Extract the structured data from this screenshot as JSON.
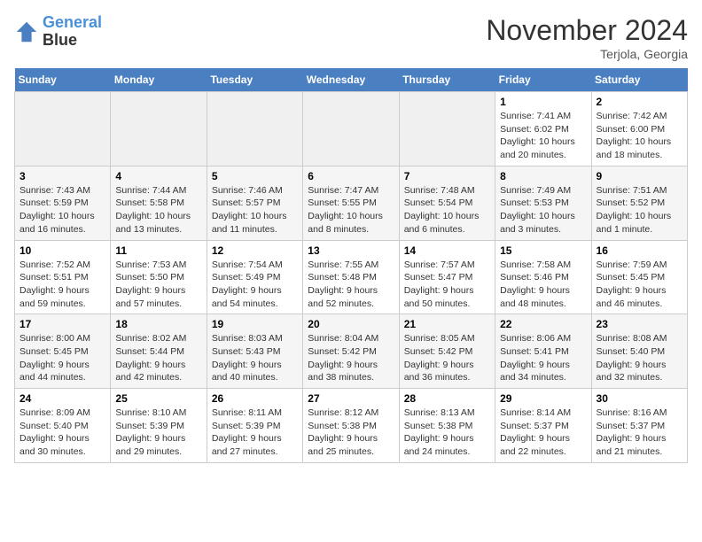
{
  "logo": {
    "line1": "General",
    "line2": "Blue"
  },
  "title": "November 2024",
  "location": "Terjola, Georgia",
  "days_of_week": [
    "Sunday",
    "Monday",
    "Tuesday",
    "Wednesday",
    "Thursday",
    "Friday",
    "Saturday"
  ],
  "weeks": [
    [
      {
        "day": "",
        "sunrise": "",
        "sunset": "",
        "daylight": ""
      },
      {
        "day": "",
        "sunrise": "",
        "sunset": "",
        "daylight": ""
      },
      {
        "day": "",
        "sunrise": "",
        "sunset": "",
        "daylight": ""
      },
      {
        "day": "",
        "sunrise": "",
        "sunset": "",
        "daylight": ""
      },
      {
        "day": "",
        "sunrise": "",
        "sunset": "",
        "daylight": ""
      },
      {
        "day": "1",
        "sunrise": "Sunrise: 7:41 AM",
        "sunset": "Sunset: 6:02 PM",
        "daylight": "Daylight: 10 hours and 20 minutes."
      },
      {
        "day": "2",
        "sunrise": "Sunrise: 7:42 AM",
        "sunset": "Sunset: 6:00 PM",
        "daylight": "Daylight: 10 hours and 18 minutes."
      }
    ],
    [
      {
        "day": "3",
        "sunrise": "Sunrise: 7:43 AM",
        "sunset": "Sunset: 5:59 PM",
        "daylight": "Daylight: 10 hours and 16 minutes."
      },
      {
        "day": "4",
        "sunrise": "Sunrise: 7:44 AM",
        "sunset": "Sunset: 5:58 PM",
        "daylight": "Daylight: 10 hours and 13 minutes."
      },
      {
        "day": "5",
        "sunrise": "Sunrise: 7:46 AM",
        "sunset": "Sunset: 5:57 PM",
        "daylight": "Daylight: 10 hours and 11 minutes."
      },
      {
        "day": "6",
        "sunrise": "Sunrise: 7:47 AM",
        "sunset": "Sunset: 5:55 PM",
        "daylight": "Daylight: 10 hours and 8 minutes."
      },
      {
        "day": "7",
        "sunrise": "Sunrise: 7:48 AM",
        "sunset": "Sunset: 5:54 PM",
        "daylight": "Daylight: 10 hours and 6 minutes."
      },
      {
        "day": "8",
        "sunrise": "Sunrise: 7:49 AM",
        "sunset": "Sunset: 5:53 PM",
        "daylight": "Daylight: 10 hours and 3 minutes."
      },
      {
        "day": "9",
        "sunrise": "Sunrise: 7:51 AM",
        "sunset": "Sunset: 5:52 PM",
        "daylight": "Daylight: 10 hours and 1 minute."
      }
    ],
    [
      {
        "day": "10",
        "sunrise": "Sunrise: 7:52 AM",
        "sunset": "Sunset: 5:51 PM",
        "daylight": "Daylight: 9 hours and 59 minutes."
      },
      {
        "day": "11",
        "sunrise": "Sunrise: 7:53 AM",
        "sunset": "Sunset: 5:50 PM",
        "daylight": "Daylight: 9 hours and 57 minutes."
      },
      {
        "day": "12",
        "sunrise": "Sunrise: 7:54 AM",
        "sunset": "Sunset: 5:49 PM",
        "daylight": "Daylight: 9 hours and 54 minutes."
      },
      {
        "day": "13",
        "sunrise": "Sunrise: 7:55 AM",
        "sunset": "Sunset: 5:48 PM",
        "daylight": "Daylight: 9 hours and 52 minutes."
      },
      {
        "day": "14",
        "sunrise": "Sunrise: 7:57 AM",
        "sunset": "Sunset: 5:47 PM",
        "daylight": "Daylight: 9 hours and 50 minutes."
      },
      {
        "day": "15",
        "sunrise": "Sunrise: 7:58 AM",
        "sunset": "Sunset: 5:46 PM",
        "daylight": "Daylight: 9 hours and 48 minutes."
      },
      {
        "day": "16",
        "sunrise": "Sunrise: 7:59 AM",
        "sunset": "Sunset: 5:45 PM",
        "daylight": "Daylight: 9 hours and 46 minutes."
      }
    ],
    [
      {
        "day": "17",
        "sunrise": "Sunrise: 8:00 AM",
        "sunset": "Sunset: 5:45 PM",
        "daylight": "Daylight: 9 hours and 44 minutes."
      },
      {
        "day": "18",
        "sunrise": "Sunrise: 8:02 AM",
        "sunset": "Sunset: 5:44 PM",
        "daylight": "Daylight: 9 hours and 42 minutes."
      },
      {
        "day": "19",
        "sunrise": "Sunrise: 8:03 AM",
        "sunset": "Sunset: 5:43 PM",
        "daylight": "Daylight: 9 hours and 40 minutes."
      },
      {
        "day": "20",
        "sunrise": "Sunrise: 8:04 AM",
        "sunset": "Sunset: 5:42 PM",
        "daylight": "Daylight: 9 hours and 38 minutes."
      },
      {
        "day": "21",
        "sunrise": "Sunrise: 8:05 AM",
        "sunset": "Sunset: 5:42 PM",
        "daylight": "Daylight: 9 hours and 36 minutes."
      },
      {
        "day": "22",
        "sunrise": "Sunrise: 8:06 AM",
        "sunset": "Sunset: 5:41 PM",
        "daylight": "Daylight: 9 hours and 34 minutes."
      },
      {
        "day": "23",
        "sunrise": "Sunrise: 8:08 AM",
        "sunset": "Sunset: 5:40 PM",
        "daylight": "Daylight: 9 hours and 32 minutes."
      }
    ],
    [
      {
        "day": "24",
        "sunrise": "Sunrise: 8:09 AM",
        "sunset": "Sunset: 5:40 PM",
        "daylight": "Daylight: 9 hours and 30 minutes."
      },
      {
        "day": "25",
        "sunrise": "Sunrise: 8:10 AM",
        "sunset": "Sunset: 5:39 PM",
        "daylight": "Daylight: 9 hours and 29 minutes."
      },
      {
        "day": "26",
        "sunrise": "Sunrise: 8:11 AM",
        "sunset": "Sunset: 5:39 PM",
        "daylight": "Daylight: 9 hours and 27 minutes."
      },
      {
        "day": "27",
        "sunrise": "Sunrise: 8:12 AM",
        "sunset": "Sunset: 5:38 PM",
        "daylight": "Daylight: 9 hours and 25 minutes."
      },
      {
        "day": "28",
        "sunrise": "Sunrise: 8:13 AM",
        "sunset": "Sunset: 5:38 PM",
        "daylight": "Daylight: 9 hours and 24 minutes."
      },
      {
        "day": "29",
        "sunrise": "Sunrise: 8:14 AM",
        "sunset": "Sunset: 5:37 PM",
        "daylight": "Daylight: 9 hours and 22 minutes."
      },
      {
        "day": "30",
        "sunrise": "Sunrise: 8:16 AM",
        "sunset": "Sunset: 5:37 PM",
        "daylight": "Daylight: 9 hours and 21 minutes."
      }
    ]
  ]
}
